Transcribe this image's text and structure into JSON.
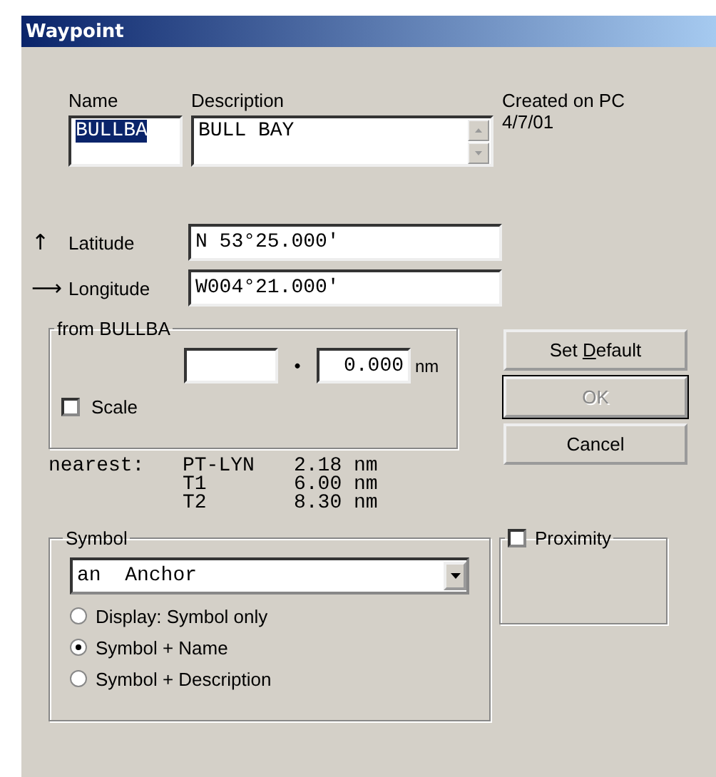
{
  "window": {
    "title": "Waypoint"
  },
  "name": {
    "label": "Name",
    "value": "BULLBA",
    "selected": true
  },
  "description": {
    "label": "Description",
    "value": "BULL BAY"
  },
  "created": [
    "Created on PC",
    "4/7/01"
  ],
  "coordinates": [
    {
      "label": "Latitude",
      "value": "N 53°25.000'",
      "arrow": "↑"
    },
    {
      "label": "Longitude",
      "value": "W004°21.000'",
      "arrow": "⟶"
    }
  ],
  "from_group": {
    "title": "from BULLBA",
    "dot": "•",
    "distance": "0.000",
    "unit": "nm",
    "scale": {
      "label": "Scale",
      "checked": false
    }
  },
  "buttons": [
    {
      "label": "Set ",
      "mnemonic": "D",
      "label_rest": "efault",
      "disabled": false
    },
    {
      "label": "OK",
      "disabled": true
    },
    {
      "label": "Cancel",
      "disabled": false
    }
  ],
  "nearest": {
    "label": "nearest:",
    "rows": [
      {
        "name": "PT-LYN",
        "distance": "2.18 nm"
      },
      {
        "name": "T1",
        "distance": "6.00 nm"
      },
      {
        "name": "T2",
        "distance": "8.30 nm"
      }
    ]
  },
  "symbol": {
    "title": "Symbol",
    "value": "an  Anchor",
    "options": [
      {
        "label": "Display: Symbol only",
        "selected": false
      },
      {
        "label": "Symbol + Name",
        "selected": true
      },
      {
        "label": "Symbol + Description",
        "selected": false
      }
    ]
  },
  "proximity": {
    "label": "Proximity",
    "checked": false
  }
}
